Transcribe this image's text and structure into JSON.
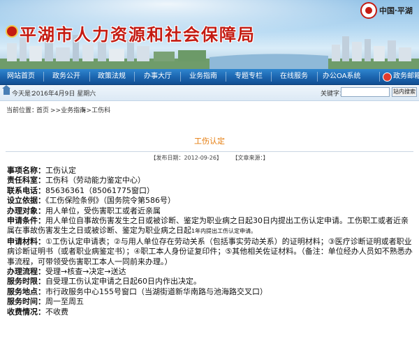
{
  "banner": {
    "title": "平湖市人力资源和社会保障局",
    "corner_logo_text": "中国·平湖"
  },
  "nav": {
    "items": [
      "网站首页",
      "政务公开",
      "政策法规",
      "办事大厅",
      "业务指南",
      "专题专栏",
      "在线服务",
      "办公OA系统",
      "政务邮箱"
    ]
  },
  "toprow": {
    "date_label": "今天是：",
    "date_value": "2016年4月9日 星期六",
    "keyword_label": "关键字：",
    "keyword_value": "",
    "search_button": "站内搜索"
  },
  "breadcrumb": {
    "label": "当前位置：",
    "items": [
      "首页",
      ">>业务指南",
      ">>工伤科"
    ]
  },
  "article": {
    "title": "工伤认定",
    "publish": "【发布日期：2012-09-26】",
    "source": "【文章来源：】",
    "fields": [
      {
        "label": "事项名称：",
        "value": "工伤认定"
      },
      {
        "label": "责任科室：",
        "value": "工伤科（劳动能力鉴定中心）"
      },
      {
        "label": "联系电话：",
        "value": "85636361（85061775窗口）"
      },
      {
        "label": "设立依据：",
        "value": "《工伤保险条例》（国务院令第586号）"
      },
      {
        "label": "办理对象：",
        "value": "用人单位，受伤害职工或者近亲属"
      },
      {
        "label": "申请条件：",
        "value": "用人单位自事故伤害发生之日或被诊断、鉴定为职业病之日起30日内提出工伤认定申请。工伤职工或者近亲属在事故伤害发生之日或被诊断、鉴定为职业病之日起",
        "tail_small": "1年内提出工伤认定申请。"
      },
      {
        "label": "申请材料：",
        "value": "①工伤认定申请表；②与用人单位存在劳动关系（包括事实劳动关系）的证明材料；③医疗诊断证明或者职业病诊断证明书（或者职业病鉴定书）；④职工本人身份证复印件；⑤其他相关佐证材料。（备注：单位经办人员如不熟悉办事流程，可带领受伤害职工本人一同前来办理。）"
      },
      {
        "label": "办理流程：",
        "value": "受理→核查→决定→送达"
      },
      {
        "label": "服务时限：",
        "value": "自受理工伤认定申请之日起60日内作出决定。"
      },
      {
        "label": "服务地点：",
        "value": "市行政服务中心155号窗口（当湖街道新华南路与池海路交叉口）"
      },
      {
        "label": "服务时间：",
        "value": "周一至周五"
      },
      {
        "label": "收费情况：",
        "value": "不收费"
      }
    ]
  },
  "colors": {
    "nav_blue": "#1b64ae",
    "title_red": "#c41b12",
    "article_title_orange": "#e67d0e"
  }
}
